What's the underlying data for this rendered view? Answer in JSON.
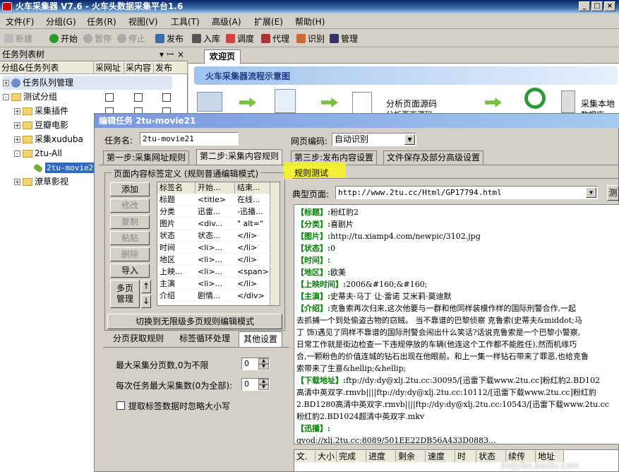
{
  "window": {
    "title": "火车采集器 V7.6 - 火车头数据采集平台1.6"
  },
  "menu": [
    "文件(F)",
    "分组(G)",
    "任务(R)",
    "视图(V)",
    "工具(T)",
    "高级(A)",
    "扩展(E)",
    "帮助(H)"
  ],
  "toolbar": {
    "new": "新建",
    "start": "开始",
    "pause": "暂停",
    "stop": "停止",
    "publish": "发布",
    "import": "入库",
    "debug": "调度",
    "proxy": "代理",
    "recognize": "识别",
    "manage": "管理"
  },
  "left_panel": {
    "title": "任务列表树",
    "columns": [
      "分组&任务列表",
      "采网址",
      "采内容",
      "发布"
    ],
    "tree": [
      "任务队列管理",
      "测试分组",
      "采集插件",
      "豆瓣电影",
      "采集xuduba",
      "2tu-All",
      "2tu-movie2",
      "潦草影视"
    ]
  },
  "main": {
    "tab": "欢迎页",
    "flow_title": "火车采集器流程示意图",
    "flow_step1": "分析页面源码",
    "flow_step1b": "分析页面源码",
    "flow_step2": "采集本地",
    "flow_step2b": "数据库"
  },
  "dialog": {
    "title": "编辑任务 2tu-movie21",
    "task_name_label": "任务名:",
    "task_name": "2tu-movie21",
    "encoding_label": "网页编码:",
    "encoding": "自动识别",
    "tabs": [
      "第一步:采集网址规则",
      "第二步:采集内容规则",
      "第三步:发布内容设置",
      "文件保存及部分高级设置"
    ],
    "group_title": "页面内容标签定义 (规则普通编辑模式)",
    "buttons": {
      "add": "添加",
      "edit": "修改",
      "copy": "复制",
      "paste": "粘贴",
      "delete": "删除",
      "import": "导入",
      "multipage1": "多页",
      "multipage2": "管理",
      "up": "↑",
      "down": "↓",
      "switch_mode": "切换到无限级多页规则编辑模式"
    },
    "grid_headers": [
      "标签名",
      "开始...",
      "结束..."
    ],
    "grid_rows": [
      [
        "标题",
        "<title>",
        "在线..."
      ],
      [
        "分类",
        "迅雷...",
        "-迅播..."
      ],
      [
        "图片",
        "<div...",
        "\" alt=\""
      ],
      [
        "状态",
        "状态...",
        "</li>"
      ],
      [
        "时间",
        "<li>...",
        "</li>"
      ],
      [
        "地区",
        "<li>...",
        "</li>"
      ],
      [
        "上映...",
        "<li>...",
        "<span>"
      ],
      [
        "主演",
        "<li>...",
        "</li>"
      ],
      [
        "介绍",
        "剧情...",
        "</div>"
      ]
    ],
    "subtabs": [
      "分页获取规则",
      "标签循环处理",
      "其他设置"
    ],
    "max_pages_label": "最大采集分页数,0为不限",
    "max_pages": "0",
    "max_count_label": "每次任务最大采集数(0为全部):",
    "max_count": "0",
    "ignore_case_label": "提取标签数据时忽略大小写",
    "rule_test_label": "规则测试",
    "typical_page_label": "典型页面:",
    "typical_page_url": "http://www.2tu.cc/Html/GP17794.html",
    "test_button": "测",
    "preview_lines": [
      {
        "key": "【标题】:",
        "val": "粉红豹2"
      },
      {
        "key": "【分类】:",
        "val": "喜剧片"
      },
      {
        "key": "【图片】:",
        "val": "http://tu.xiamp4.com/newpic/3102.jpg"
      },
      {
        "key": "【状态】:",
        "val": "0"
      },
      {
        "key": "【时间】:",
        "val": ""
      },
      {
        "key": "【地区】:",
        "val": "欧美"
      },
      {
        "key": "【上映时间】:",
        "val": "2006&#160;&#160;"
      },
      {
        "key": "【主演】:",
        "val": "史蒂夫·马丁 让·雷诺 艾米莉·莫迪默"
      },
      {
        "key": "【介绍】:",
        "val": "克鲁索再次归来,这次他要与一群和他同样装模作样的国际刑警合作,一起"
      },
      {
        "key": "",
        "val": "去抓捕一个到处偷盗古物的窃贼。   当不靠谱的巴黎侦察 克鲁索(史蒂夫&middot;马"
      },
      {
        "key": "",
        "val": "丁 饰)遇见了同样不靠谱的国际刑警会闹出什么笑话?话说克鲁索是一个巴黎小警察,"
      },
      {
        "key": "",
        "val": "日常工作就是街边检查一下违规停放的车辆(他连这个工作都不能胜任),然而机缘巧"
      },
      {
        "key": "",
        "val": "合,一颗粉色的价值连城的钻石出现在他眼前。和上一集一样钻石带来了罪恶,也给克鲁"
      },
      {
        "key": "",
        "val": "索带来了生意&hellip;&hellip;"
      },
      {
        "key": "【下载地址】:",
        "val": "ftp://dy:dy@xlj.2tu.cc:30095/[迅雷下载www.2tu.cc]粉红豹2.BD102"
      },
      {
        "key": "",
        "val": "高清中英双字.rmvb||||ftp://dy:dy@xlj.2tu.cc:10112/[迅雷下载www.2tu.cc]粉红豹"
      },
      {
        "key": "",
        "val": "2.BD1280高清中英双字.rmvb||||ftp://dy:dy@xlj.2tu.cc:10543/[迅雷下载www.2tu.cc"
      },
      {
        "key": "",
        "val": "粉红豹2.BD1024超清中英双字.mkv"
      },
      {
        "key": "【迅播】:",
        "val": ""
      },
      {
        "key": "",
        "val": "gvod://xlj.2tu.cc:8089/501EE22DB56A433D0883..."
      }
    ],
    "status_headers": [
      "文.",
      "大小",
      "完成",
      "进度",
      "剩余",
      "速度",
      "时",
      "状态",
      "续传",
      "地址"
    ],
    "watermark": "jingyan.baidu.com"
  }
}
